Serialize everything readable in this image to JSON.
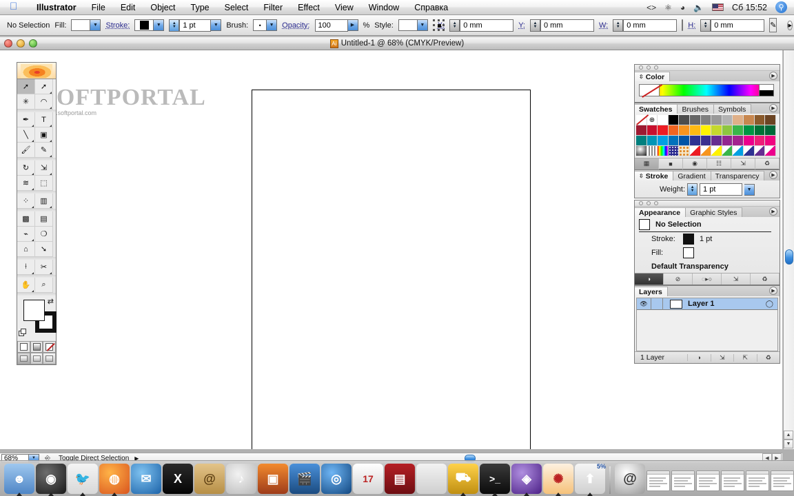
{
  "menubar": {
    "apple_icon": "apple-logo-icon",
    "items": [
      {
        "label": "Illustrator",
        "bold": true
      },
      {
        "label": "File",
        "bold": false
      },
      {
        "label": "Edit",
        "bold": false
      },
      {
        "label": "Object",
        "bold": false
      },
      {
        "label": "Type",
        "bold": false
      },
      {
        "label": "Select",
        "bold": false
      },
      {
        "label": "Filter",
        "bold": false
      },
      {
        "label": "Effect",
        "bold": false
      },
      {
        "label": "View",
        "bold": false
      },
      {
        "label": "Window",
        "bold": false
      },
      {
        "label": "Справка",
        "bold": false
      }
    ],
    "status_icons": [
      "display-switch-icon",
      "bluetooth-icon",
      "wifi-icon",
      "volume-icon"
    ],
    "input_flag": "us-flag-icon",
    "clock": "Сб 15:52",
    "spotlight_icon": "search-icon"
  },
  "controlbar": {
    "selection_status": "No Selection",
    "fill_label": "Fill:",
    "stroke_label": "Stroke:",
    "stroke_weight": "1 pt",
    "brush_label": "Brush:",
    "opacity_label": "Opacity:",
    "opacity_value": "100",
    "percent": "%",
    "style_label": "Style:",
    "x_label": "X:",
    "x_value": "0 mm",
    "y_label": "Y:",
    "y_value": "0 mm",
    "w_label": "W:",
    "w_value": "0 mm",
    "h_label": "H:",
    "h_value": "0 mm",
    "link_icon": "chain-link-icon",
    "refpoint_icon": "reference-point-icon",
    "doc_setup_icon": "document-setup-icon",
    "expand_icon": "panel-menu-icon"
  },
  "document": {
    "title": "Untitled-1 @ 68% (CMYK/Preview)",
    "app_icon": "illustrator-document-icon",
    "watermark": "SOFTPORTAL",
    "watermark_sub": "www.softportal.com",
    "close_icon": "close-window-icon",
    "minimize_icon": "minimize-window-icon",
    "zoom_icon": "maximize-window-icon"
  },
  "statusbar": {
    "zoom_value": "68%",
    "dropdown_icon": "chevron-down-icon",
    "tool_icon": "direct-selection-status-icon",
    "status_text": "Toggle Direct Selection",
    "menu_triangle": "▶"
  },
  "toolbox": {
    "header_icon": "illustrator-splash-flower-icon",
    "tools": [
      {
        "name": "selection-tool",
        "glyph": "➚",
        "selected": true,
        "hasMore": false
      },
      {
        "name": "direct-selection-tool",
        "glyph": "➚",
        "selected": false,
        "hasMore": true
      },
      {
        "name": "magic-wand-tool",
        "glyph": "✳",
        "selected": false,
        "hasMore": false
      },
      {
        "name": "lasso-tool",
        "glyph": "◠",
        "selected": false,
        "hasMore": true
      },
      {
        "name": "pen-tool",
        "glyph": "✒",
        "selected": false,
        "hasMore": true
      },
      {
        "name": "type-tool",
        "glyph": "T",
        "selected": false,
        "hasMore": true
      },
      {
        "name": "line-segment-tool",
        "glyph": "╲",
        "selected": false,
        "hasMore": true
      },
      {
        "name": "rectangle-tool",
        "glyph": "▣",
        "selected": false,
        "hasMore": true
      },
      {
        "name": "paintbrush-tool",
        "glyph": "🖌",
        "selected": false,
        "hasMore": false
      },
      {
        "name": "pencil-tool",
        "glyph": "✎",
        "selected": false,
        "hasMore": true
      },
      {
        "name": "rotate-tool",
        "glyph": "↻",
        "selected": false,
        "hasMore": true
      },
      {
        "name": "scale-tool",
        "glyph": "⇲",
        "selected": false,
        "hasMore": true
      },
      {
        "name": "warp-tool",
        "glyph": "≋",
        "selected": false,
        "hasMore": true
      },
      {
        "name": "free-transform-tool",
        "glyph": "⬚",
        "selected": false,
        "hasMore": false
      },
      {
        "name": "symbol-sprayer-tool",
        "glyph": "⁘",
        "selected": false,
        "hasMore": true
      },
      {
        "name": "column-graph-tool",
        "glyph": "▥",
        "selected": false,
        "hasMore": true
      },
      {
        "name": "mesh-tool",
        "glyph": "▩",
        "selected": false,
        "hasMore": false
      },
      {
        "name": "gradient-tool",
        "glyph": "▤",
        "selected": false,
        "hasMore": false
      },
      {
        "name": "eyedropper-tool",
        "glyph": "⌁",
        "selected": false,
        "hasMore": true
      },
      {
        "name": "blend-tool",
        "glyph": "❍",
        "selected": false,
        "hasMore": false
      },
      {
        "name": "live-paint-bucket-tool",
        "glyph": "⌂",
        "selected": false,
        "hasMore": false
      },
      {
        "name": "live-paint-selection-tool",
        "glyph": "➘",
        "selected": false,
        "hasMore": false
      },
      {
        "name": "slice-tool",
        "glyph": "⟊",
        "selected": false,
        "hasMore": true
      },
      {
        "name": "scissors-tool",
        "glyph": "✂",
        "selected": false,
        "hasMore": true
      },
      {
        "name": "hand-tool",
        "glyph": "✋",
        "selected": false,
        "hasMore": true
      },
      {
        "name": "zoom-tool",
        "glyph": "⌕",
        "selected": false,
        "hasMore": false
      }
    ],
    "fill_color": "#ffffff",
    "stroke_color": "#000000",
    "swap_icon": "swap-fill-stroke-icon",
    "default_icon": "default-fill-stroke-icon",
    "paint_modes": [
      "solid-color-mode",
      "gradient-mode",
      "none-mode"
    ],
    "screen_modes": [
      "standard-screen-mode",
      "full-screen-with-menubar-mode",
      "full-screen-mode"
    ]
  },
  "panels": {
    "color": {
      "tab": "Color",
      "menu_icon": "panel-menu-icon",
      "none_swatch": "none-color-icon",
      "ramp": "color-spectrum-ramp"
    },
    "swatches": {
      "tabs": [
        "Swatches",
        "Brushes",
        "Symbols"
      ],
      "active_tab": "Swatches",
      "menu_icon": "panel-menu-icon",
      "rows": [
        [
          "none",
          "registration",
          "#ffffff",
          "#000000",
          "#4d4d4d",
          "#666666",
          "#808080",
          "#999999",
          "#b3b3b3",
          "#e0b088",
          "#c8874f",
          "#8a5a2b",
          "#6b4423"
        ],
        [
          "#9e1b32",
          "#c8102e",
          "#ed1c24",
          "#f26522",
          "#f7941e",
          "#fdb913",
          "#fff200",
          "#c5d92d",
          "#8dc63f",
          "#39b54a",
          "#009444",
          "#007236",
          "#006838"
        ],
        [
          "#00807e",
          "#0096b7",
          "#00a0e3",
          "#0072bc",
          "#0054a6",
          "#2e3192",
          "#3b2f8f",
          "#662d91",
          "#92278f",
          "#a3238e",
          "#ec008c",
          "#ed1e79",
          "#f0047f"
        ],
        [
          "sphere-gradient",
          "metal-gradient",
          "rainbow-gradient",
          "confetti-pattern",
          "floral-pattern",
          "#ed1c24",
          "#f7941e",
          "#fff200",
          "#39b54a",
          "#00a0e3",
          "#2e3192",
          "#662d91",
          "#ec008c"
        ]
      ],
      "footer_buttons": [
        "show-all-swatches",
        "show-color-swatches",
        "show-gradient-swatches",
        "show-pattern-swatches",
        "new-swatch",
        "delete-swatch"
      ]
    },
    "stroke": {
      "tabs": [
        "Stroke",
        "Gradient",
        "Transparency"
      ],
      "active_tab": "Stroke",
      "weight_label": "Weight:",
      "weight_value": "1 pt",
      "menu_icon": "panel-menu-icon"
    },
    "appearance": {
      "tabs": [
        "Appearance",
        "Graphic Styles"
      ],
      "active_tab": "Appearance",
      "menu_icon": "panel-menu-icon",
      "header": "No Selection",
      "rows": [
        {
          "label": "Stroke:",
          "value": "1 pt",
          "swatch": "black"
        },
        {
          "label": "Fill:",
          "value": "",
          "swatch": "white"
        }
      ],
      "transparency_row": "Default Transparency",
      "footer_buttons": [
        "new-art-maintains-appearance",
        "clear-appearance",
        "reduce-to-basic-appearance",
        "duplicate-item",
        "delete-item"
      ]
    },
    "layers": {
      "tab": "Layers",
      "menu_icon": "panel-menu-icon",
      "rows": [
        {
          "name": "Layer 1",
          "visible": true,
          "locked": false,
          "selected": true,
          "eye_icon": "eye-icon",
          "target_icon": "target-circle-icon"
        }
      ],
      "count_label": "1 Layer",
      "footer_buttons": [
        "make-clipping-mask",
        "create-new-sublayer",
        "create-new-layer",
        "delete-selection"
      ]
    }
  },
  "dock": {
    "items": [
      {
        "name": "finder",
        "glyph": "☻",
        "bg": "linear-gradient(180deg,#9fc8ef,#4f86c6)",
        "running": true
      },
      {
        "name": "dashboard",
        "glyph": "◉",
        "bg": "radial-gradient(circle at 35% 30%,#6d6d6d,#1a1a1a)",
        "running": true
      },
      {
        "name": "camino",
        "glyph": "🐦",
        "bg": "linear-gradient(180deg,#f4f4f4,#d8d8d8)",
        "running": true
      },
      {
        "name": "firefox",
        "glyph": "◍",
        "bg": "radial-gradient(circle at 35% 30%,#ffb347,#d9541e)",
        "running": true
      },
      {
        "name": "thunderbird",
        "glyph": "✉",
        "bg": "radial-gradient(circle at 35% 30%,#7fc2f0,#1b62a8)",
        "running": false
      },
      {
        "name": "x11",
        "glyph": "X",
        "bg": "linear-gradient(180deg,#2a2a2a,#050505)",
        "running": false
      },
      {
        "name": "address-book",
        "glyph": "@",
        "bg": "linear-gradient(180deg,#e3c48a,#b78f46)",
        "running": false
      },
      {
        "name": "itunes",
        "glyph": "♪",
        "bg": "radial-gradient(circle at 40% 35%,#f2f2f2,#b9b9b9)",
        "running": false
      },
      {
        "name": "iphoto",
        "glyph": "▣",
        "bg": "linear-gradient(180deg,#f28a2e,#9e3c1a)",
        "running": false
      },
      {
        "name": "imovie",
        "glyph": "🎬",
        "bg": "linear-gradient(180deg,#4a90d9,#1b4b80)",
        "running": false
      },
      {
        "name": "idvd",
        "glyph": "◎",
        "bg": "radial-gradient(circle at 35% 30%,#6fb6f5,#11467f)",
        "running": false
      },
      {
        "name": "ical",
        "glyph": "17",
        "bg": "linear-gradient(180deg,#ffffff,#d4d4d4)",
        "running": false
      },
      {
        "name": "front-row",
        "glyph": "▤",
        "bg": "linear-gradient(180deg,#b51f24,#6d0e12)",
        "running": false
      },
      {
        "name": "system-preferences",
        "glyph": "",
        "bg": "linear-gradient(180deg,#f2f2f2,#cfcfcf)",
        "running": false
      },
      {
        "name": "forklift",
        "glyph": "⛟",
        "bg": "linear-gradient(180deg,#ffd24a,#c08f12)",
        "running": true
      },
      {
        "name": "terminal",
        "glyph": "&gt;_",
        "bg": "linear-gradient(180deg,#3a3a3a,#0b0b0b)",
        "running": true
      },
      {
        "name": "disc-utility",
        "glyph": "◈",
        "bg": "radial-gradient(circle at 35% 30%,#b08fe0,#4b1f86)",
        "running": true
      },
      {
        "name": "illustrator",
        "glyph": "✺",
        "bg": "linear-gradient(180deg,#fdf1e0,#f6c27a)",
        "running": true
      },
      {
        "name": "network-upload",
        "glyph": "⬆",
        "bg": "linear-gradient(180deg,#f5f5f5,#d0d0d0)",
        "running": true,
        "badge": "5%"
      }
    ],
    "minimized": [
      {
        "name": "mail-at-icon"
      },
      {
        "name": "minimized-window-finder"
      },
      {
        "name": "minimized-window-list"
      },
      {
        "name": "minimized-window-document"
      },
      {
        "name": "minimized-window-settings"
      },
      {
        "name": "minimized-window-firefox-1"
      },
      {
        "name": "minimized-window-firefox-2"
      },
      {
        "name": "minimized-window-editor-1"
      },
      {
        "name": "minimized-window-editor-2"
      }
    ],
    "trash": {
      "name": "trash-icon"
    }
  }
}
